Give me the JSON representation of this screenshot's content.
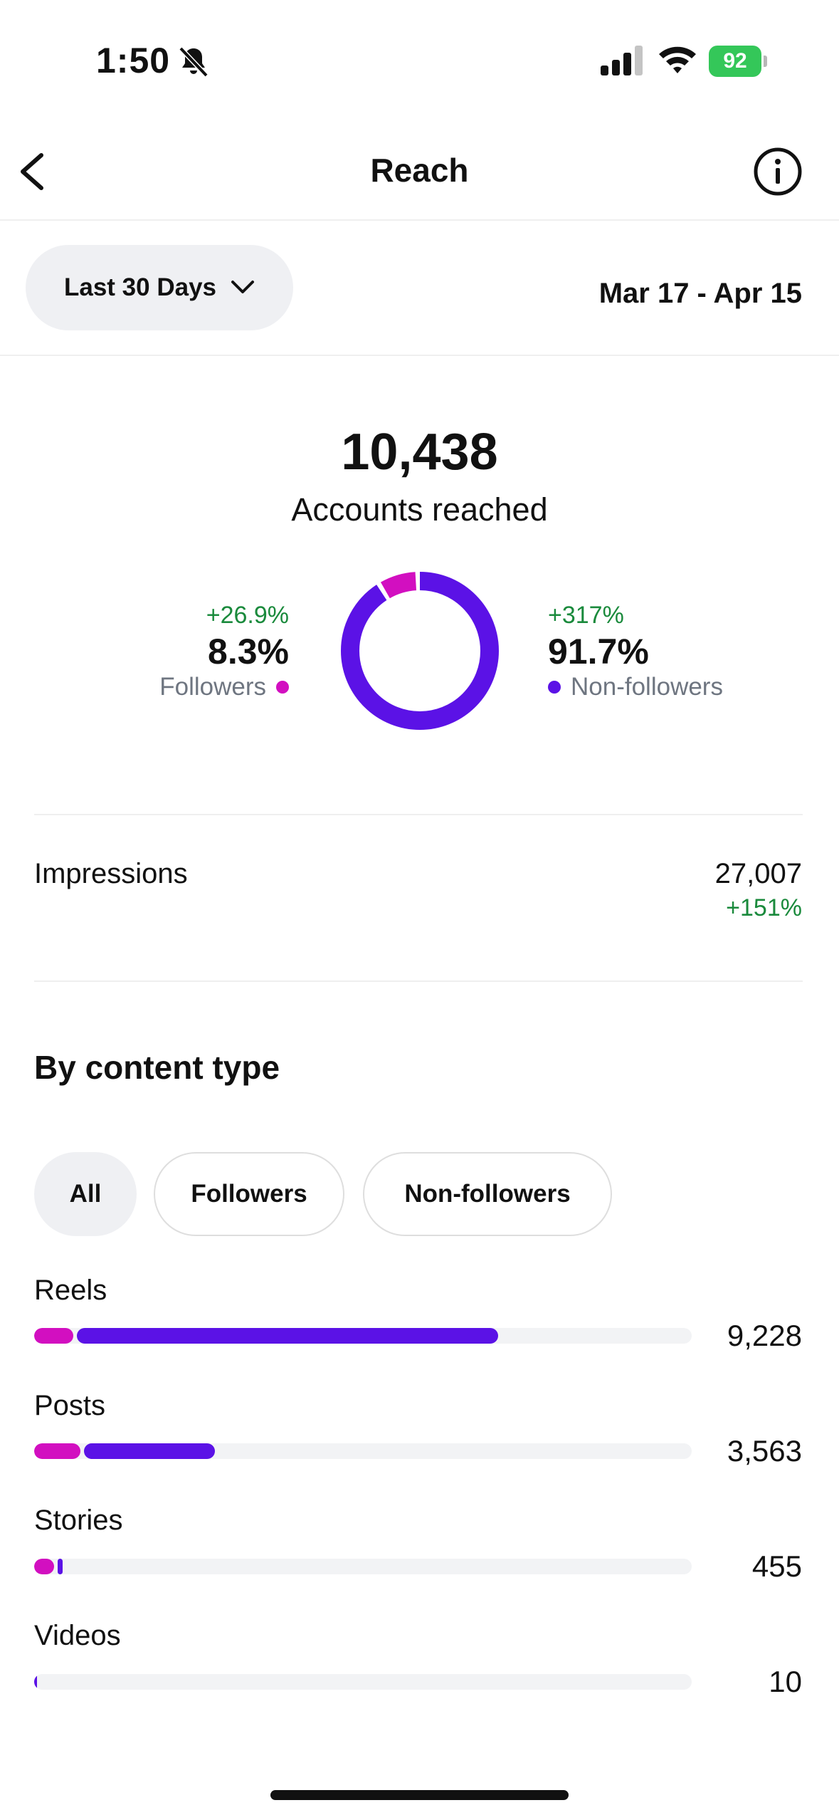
{
  "status_bar": {
    "time": "1:50",
    "battery": "92"
  },
  "header": {
    "title": "Reach"
  },
  "date_filter": {
    "label": "Last 30 Days",
    "range": "Mar 17 - Apr 15"
  },
  "summary": {
    "accounts_reached_value": "10,438",
    "accounts_reached_label": "Accounts reached",
    "followers": {
      "change": "+26.9%",
      "percent": "8.3%",
      "label": "Followers",
      "fraction": 0.083
    },
    "non_followers": {
      "change": "+317%",
      "percent": "91.7%",
      "label": "Non-followers",
      "fraction": 0.917
    }
  },
  "impressions": {
    "label": "Impressions",
    "value": "27,007",
    "change": "+151%"
  },
  "content_type": {
    "title": "By content type",
    "chips": [
      "All",
      "Followers",
      "Non-followers"
    ],
    "selected_chip": "All",
    "rows": [
      {
        "label": "Reels",
        "value": "9,228",
        "followers_fraction": 0.06,
        "non_followers_fraction": 0.64
      },
      {
        "label": "Posts",
        "value": "3,563",
        "followers_fraction": 0.07,
        "non_followers_fraction": 0.2
      },
      {
        "label": "Stories",
        "value": "455",
        "followers_fraction": 0.03,
        "non_followers_fraction": 0.008
      },
      {
        "label": "Videos",
        "value": "10",
        "followers_fraction": 0.0,
        "non_followers_fraction": 0.004
      }
    ]
  },
  "colors": {
    "followers": "#d20fc0",
    "non_followers": "#5b12e6",
    "positive": "#1a8a3c"
  }
}
